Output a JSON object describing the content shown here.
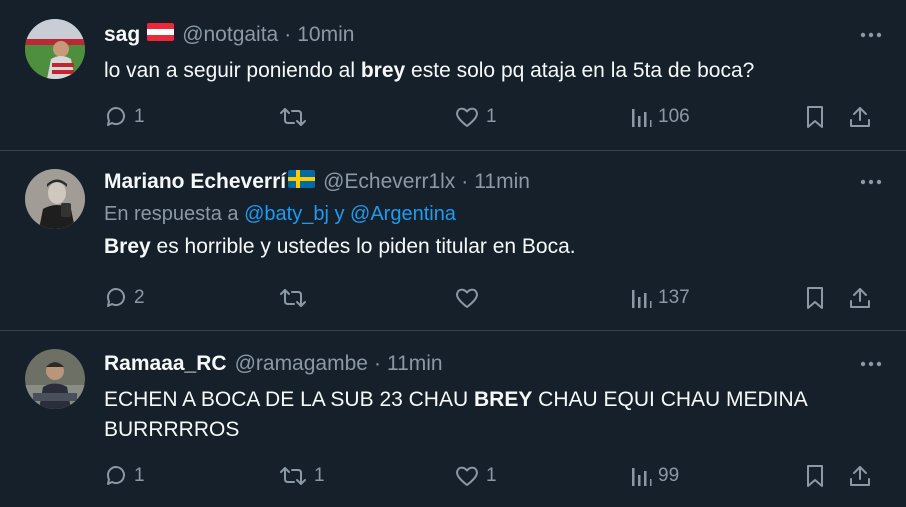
{
  "tweets": [
    {
      "name": "sag",
      "flag": "austria-flag",
      "handle": "@notgaita",
      "separator": "·",
      "time": "10min",
      "text_parts": [
        "lo van a seguir poniendo al ",
        "brey",
        " este solo pq ataja en la 5ta de boca?"
      ],
      "replies": "1",
      "retweets": "",
      "likes": "1",
      "views": "106"
    },
    {
      "name": "Mariano Echeverrí",
      "flag": "sweden-flag",
      "handle": "@Echeverr1lx",
      "separator": "·",
      "time": "11min",
      "reply_prefix": "En respuesta a ",
      "reply_mention_1": "@baty_bj",
      "reply_join": " y ",
      "reply_mention_2": "@Argentina",
      "text_parts": [
        "Brey",
        " es horrible y ustedes lo piden titular en Boca."
      ],
      "replies": "2",
      "retweets": "",
      "likes": "",
      "views": "137"
    },
    {
      "name": "Ramaaa_RC",
      "handle": "@ramagambe",
      "separator": "·",
      "time": "11min",
      "text_parts": [
        "ECHEN A BOCA DE LA SUB 23 CHAU ",
        "BREY",
        " CHAU EQUI CHAU MEDINA",
        "BURRRRROS"
      ],
      "replies": "1",
      "retweets": "1",
      "likes": "1",
      "views": "99"
    }
  ],
  "icons": [
    "reply-icon",
    "retweet-icon",
    "like-icon",
    "views-icon",
    "bookmark-icon",
    "share-icon",
    "more-icon"
  ],
  "colors": {
    "background": "#15202b",
    "text": "#f7f9f9",
    "muted": "#8b98a5",
    "link": "#1d9bf0",
    "divider": "#38444d"
  }
}
